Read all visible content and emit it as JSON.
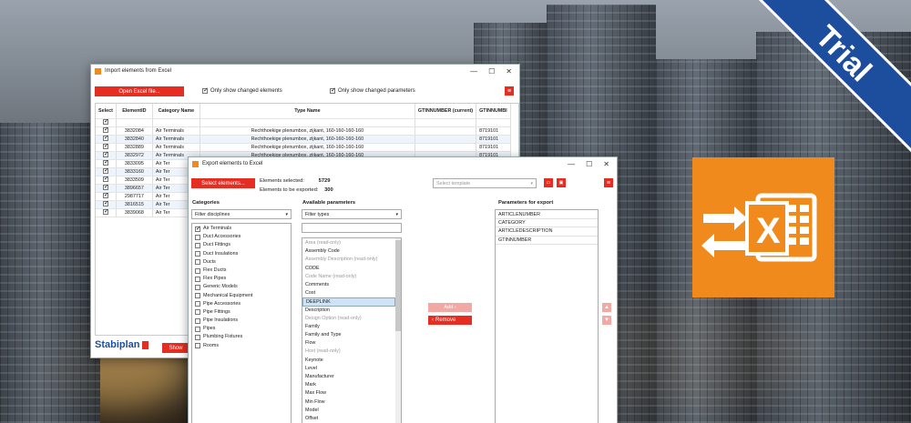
{
  "trial_label": "Trial",
  "import_window": {
    "title": "Import elements from Excel",
    "open_button": "Open Excel file...",
    "only_changed_elements": "Only show changed elements",
    "only_changed_parameters": "Only show changed parameters",
    "columns": [
      "Select",
      "ElementID",
      "Category Name",
      "Type Name",
      "GTINNUMBER (current)",
      "GTINNUMBI"
    ],
    "rows": [
      {
        "id": "3832084",
        "cat": "Air Terminals",
        "type": "Rechthoekige plenumbox, zijkant, 160-160-160-160",
        "gtin": "8719101"
      },
      {
        "id": "3832840",
        "cat": "Air Terminals",
        "type": "Rechthoekige plenumbox, zijkant, 160-160-160-160",
        "gtin": "8719101"
      },
      {
        "id": "3832889",
        "cat": "Air Terminals",
        "type": "Rechthoekige plenumbox, zijkant, 160-160-160-160",
        "gtin": "8719101"
      },
      {
        "id": "3832972",
        "cat": "Air Terminals",
        "type": "Rechthoekige plenumbox, zijkant, 160-160-160-160",
        "gtin": "8719101"
      },
      {
        "id": "3833095",
        "cat": "Air Ter",
        "type": "",
        "gtin": ""
      },
      {
        "id": "3833160",
        "cat": "Air Ter",
        "type": "",
        "gtin": ""
      },
      {
        "id": "3833509",
        "cat": "Air Ter",
        "type": "",
        "gtin": ""
      },
      {
        "id": "3896657",
        "cat": "Air Ter",
        "type": "",
        "gtin": ""
      },
      {
        "id": "2987717",
        "cat": "Air Ter",
        "type": "",
        "gtin": ""
      },
      {
        "id": "3816515",
        "cat": "Air Ter",
        "type": "",
        "gtin": ""
      },
      {
        "id": "3839068",
        "cat": "Air Ter",
        "type": "",
        "gtin": ""
      }
    ],
    "brand": "Stabiplan",
    "show_button": "Show"
  },
  "export_window": {
    "title": "Export elements to Excel",
    "select_button": "Select elements...",
    "elements_selected_label": "Elements selected:",
    "elements_selected_value": "5729",
    "elements_export_label": "Elements to be exported:",
    "elements_export_value": "300",
    "template_placeholder": "Select template",
    "categories_label": "Categories",
    "filter_disciplines": "Filter disciplines",
    "categories": [
      {
        "label": "Air Terminals",
        "checked": true
      },
      {
        "label": "Duct Accessories",
        "checked": false
      },
      {
        "label": "Duct Fittings",
        "checked": false
      },
      {
        "label": "Duct Insulations",
        "checked": false
      },
      {
        "label": "Ducts",
        "checked": false
      },
      {
        "label": "Flex Ducts",
        "checked": false
      },
      {
        "label": "Flex Pipes",
        "checked": false
      },
      {
        "label": "Generic Models",
        "checked": false
      },
      {
        "label": "Mechanical Equipment",
        "checked": false
      },
      {
        "label": "Pipe Accessories",
        "checked": false
      },
      {
        "label": "Pipe Fittings",
        "checked": false
      },
      {
        "label": "Pipe Insulations",
        "checked": false
      },
      {
        "label": "Pipes",
        "checked": false
      },
      {
        "label": "Plumbing Fixtures",
        "checked": false
      },
      {
        "label": "Rooms",
        "checked": false
      }
    ],
    "available_label": "Available parameters",
    "filter_types": "Filter types",
    "available": [
      {
        "label": "Area (read-only)",
        "gray": true
      },
      {
        "label": "Assembly Code",
        "gray": false
      },
      {
        "label": "Assembly Description (read-only)",
        "gray": true
      },
      {
        "label": "CODE",
        "gray": false
      },
      {
        "label": "Code Name (read-only)",
        "gray": true
      },
      {
        "label": "Comments",
        "gray": false
      },
      {
        "label": "Cost",
        "gray": false
      },
      {
        "label": "DEEPLINK",
        "gray": false,
        "selected": true
      },
      {
        "label": "Description",
        "gray": false
      },
      {
        "label": "Design Option (read-only)",
        "gray": true
      },
      {
        "label": "Family",
        "gray": false
      },
      {
        "label": "Family and Type",
        "gray": false
      },
      {
        "label": "Flow",
        "gray": false
      },
      {
        "label": "Host (read-only)",
        "gray": true
      },
      {
        "label": "Keynote",
        "gray": false
      },
      {
        "label": "Level",
        "gray": false
      },
      {
        "label": "Manufacturer",
        "gray": false
      },
      {
        "label": "Mark",
        "gray": false
      },
      {
        "label": "Max Flow",
        "gray": false
      },
      {
        "label": "Min Flow",
        "gray": false
      },
      {
        "label": "Model",
        "gray": false
      },
      {
        "label": "Offset",
        "gray": false
      }
    ],
    "add_button": "Add",
    "remove_button": "Remove",
    "export_label": "Parameters for export",
    "export_params": [
      "ARTICLENUMBER",
      "CATEGORY",
      "ARTICLEDESCRIPTION",
      "GTINNUMBER"
    ]
  },
  "colors": {
    "accent": "#e52d21",
    "excel_orange": "#f08a1c",
    "trial_blue": "#1d4e9e"
  }
}
